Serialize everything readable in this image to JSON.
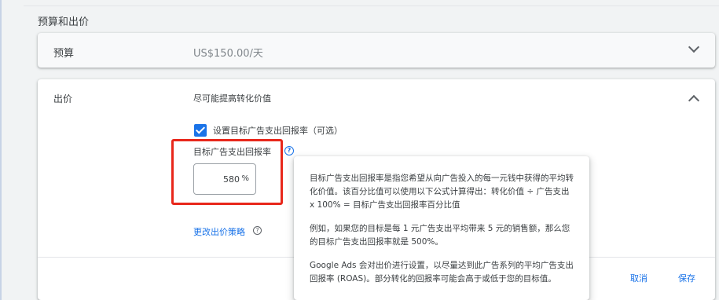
{
  "section": {
    "title": "预算和出价"
  },
  "budget": {
    "label": "预算",
    "value": "US$150.00/天"
  },
  "bid": {
    "label": "出价",
    "strategy": "尽可能提高转化价值",
    "checkbox_label": "设置目标广告支出回报率（可选）",
    "checkbox_checked": true,
    "target_label": "目标广告支出回报率",
    "target_value": "580",
    "target_unit": "%",
    "change_link": "更改出价策略",
    "cancel_label": "取消",
    "save_label": "保存"
  },
  "tooltip": {
    "paragraph_1": "目标广告支出回报率是指您希望从向广告投入的每一元钱中获得的平均转化价值。该百分比值可以使用以下公式计算得出：转化价值 ÷ 广告支出 x 100% = 目标广告支出回报率百分比值",
    "paragraph_2": "例如，如果您的目标是每 1 元广告支出平均带来 5 元的销售额，那么您的目标广告支出回报率就是 500%。",
    "paragraph_3": "Google Ads 会对出价进行设置，以尽量达到此广告系列的平均广告支出回报率 (ROAS)。部分转化的回报率可能会高于或低于您的目标值。"
  },
  "colors": {
    "accent": "#1a73e8",
    "highlight": "#e8271b"
  }
}
